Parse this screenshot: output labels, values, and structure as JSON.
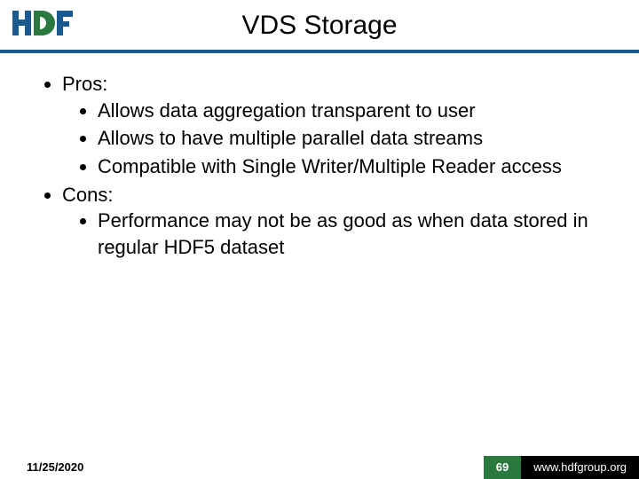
{
  "header": {
    "title": "VDS Storage",
    "logo_alt": "HDF"
  },
  "body": {
    "items": [
      {
        "label": "Pros:",
        "sub": [
          "Allows data aggregation transparent to user",
          "Allows to have multiple parallel data streams",
          "Compatible with Single Writer/Multiple Reader access"
        ]
      },
      {
        "label": "Cons:",
        "sub": [
          "Performance may not be as good as when data stored in regular HDF5 dataset"
        ]
      }
    ]
  },
  "footer": {
    "date": "11/25/2020",
    "page": "69",
    "url": "www.hdfgroup.org"
  },
  "colors": {
    "header_rule": "#1b5a8f",
    "footer_green": "#2a7a3f",
    "footer_black": "#000000"
  }
}
